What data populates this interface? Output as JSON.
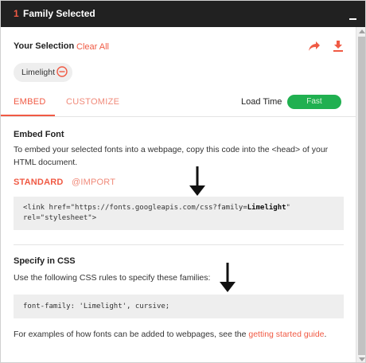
{
  "header": {
    "count": "1",
    "title": "Family Selected"
  },
  "selection": {
    "label": "Your Selection",
    "clear_all": "Clear All",
    "font_chip": "Limelight"
  },
  "tabs": {
    "embed": "EMBED",
    "customize": "CUSTOMIZE",
    "load_time_label": "Load Time",
    "load_time_value": "Fast"
  },
  "embed": {
    "title": "Embed Font",
    "description": "To embed your selected fonts into a webpage, copy this code into the <head> of your HTML document.",
    "sub_standard": "STANDARD",
    "sub_import": "@IMPORT",
    "code_pre": "<link href=\"https://fonts.googleapis.com/css?family=",
    "code_family": "Limelight",
    "code_post": "\" rel=\"stylesheet\">"
  },
  "css": {
    "title": "Specify in CSS",
    "description": "Use the following CSS rules to specify these families:",
    "code": "font-family: 'Limelight', cursive;",
    "examples_pre": "For examples of how fonts can be added to webpages, see the ",
    "examples_link": "getting started guide",
    "examples_post": "."
  },
  "colors": {
    "accent": "#f05a44",
    "header_bg": "#212121",
    "fast": "#20b050",
    "code_bg": "#eeeeee"
  },
  "icons": [
    "share-icon",
    "download-icon",
    "remove-circle-icon",
    "minimize-icon",
    "down-arrow-annotation-icon"
  ]
}
